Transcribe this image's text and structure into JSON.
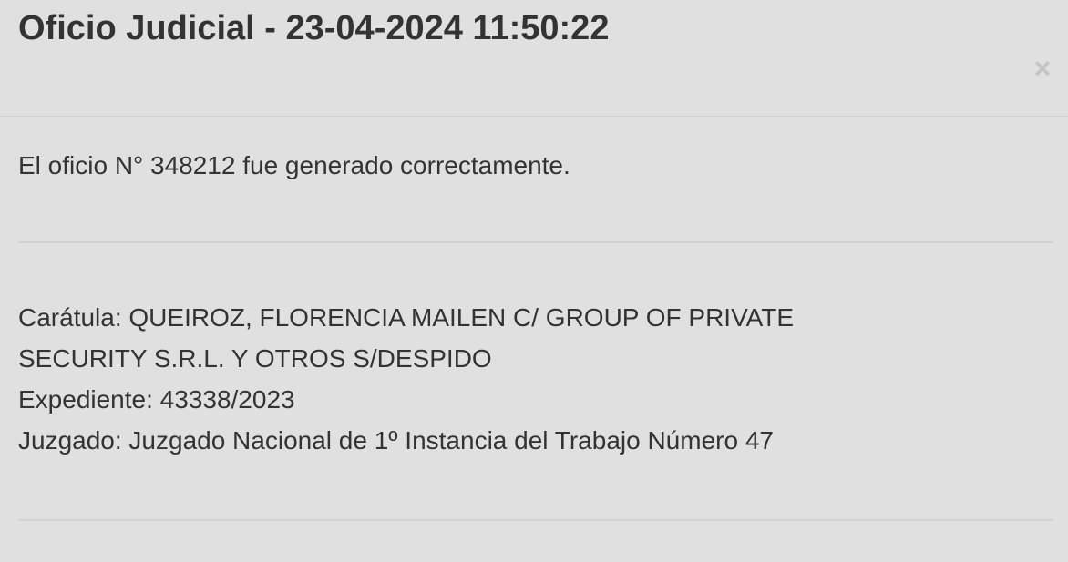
{
  "modal": {
    "title": "Oficio Judicial - 23-04-2024 11:50:22",
    "close_label": "×"
  },
  "body": {
    "message": "El oficio N° 348212 fue generado correctamente.",
    "caratula": "Carátula: QUEIROZ, FLORENCIA MAILEN C/ GROUP OF PRIVATE SECURITY S.R.L. Y OTROS S/DESPIDO",
    "expediente": "Expediente: 43338/2023",
    "juzgado": "Juzgado: Juzgado Nacional de 1º Instancia del Trabajo Número 47"
  }
}
